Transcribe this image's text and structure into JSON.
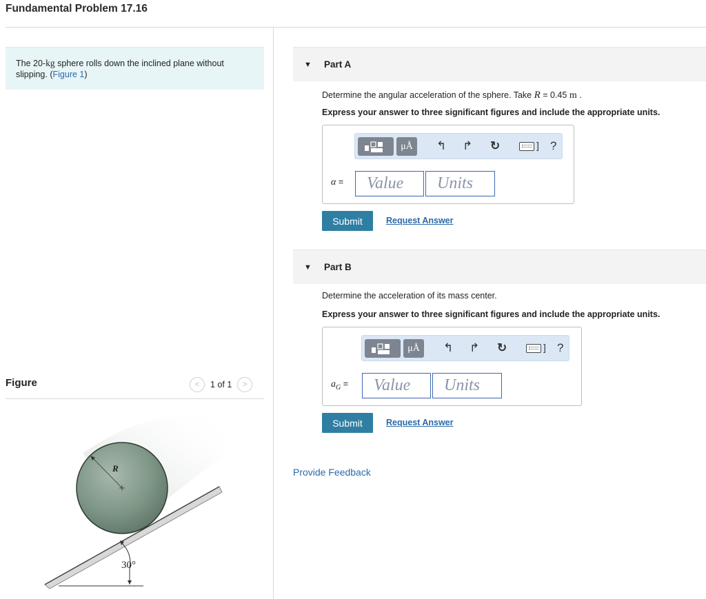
{
  "page_title": "Fundamental Problem 17.16",
  "intro": {
    "text_before": "The 20-",
    "mass_unit": "kg",
    "text_after": " sphere rolls down the inclined plane without slipping. (",
    "figure_link": "Figure 1",
    "text_end": ")"
  },
  "figure": {
    "label": "Figure",
    "pager": "1 of 1",
    "prev_glyph": "<",
    "next_glyph": ">",
    "radius_label": "R",
    "angle_label": "30°"
  },
  "part_a": {
    "title": "Part A",
    "question_before": "Determine the angular acceleration of the sphere. Take ",
    "var_name": "R",
    "question_eq": " = 0.45 ",
    "unit": "m",
    "question_end": " .",
    "instruction": "Express your answer to three significant figures and include the appropriate units.",
    "var_label": "α",
    "var_eq": " =",
    "value_placeholder": "Value",
    "units_placeholder": "Units",
    "submit_label": "Submit",
    "request_label": "Request Answer"
  },
  "part_b": {
    "title": "Part B",
    "question": "Determine the acceleration of its mass center.",
    "instruction": "Express your answer to three significant figures and include the appropriate units.",
    "var_label": "a",
    "var_sub": "G",
    "var_eq": " =",
    "value_placeholder": "Value",
    "units_placeholder": "Units",
    "submit_label": "Submit",
    "request_label": "Request Answer"
  },
  "toolbar": {
    "mu_label": "μÅ",
    "undo_glyph": "↰",
    "redo_glyph": "↱",
    "reset_glyph": "↻",
    "bracket_glyph": "]",
    "help_glyph": "?"
  },
  "feedback_label": "Provide Feedback"
}
